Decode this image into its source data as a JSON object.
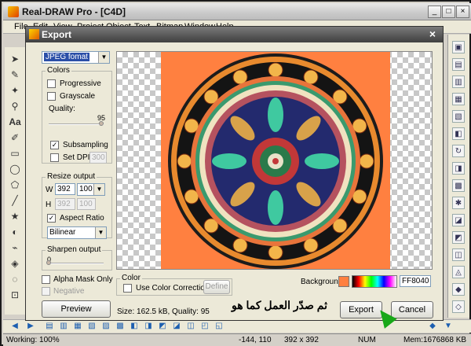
{
  "app": {
    "title": "Real-DRAW Pro - [C4D]",
    "window_buttons": [
      "_",
      "□",
      "×"
    ]
  },
  "menu": [
    "File",
    "Edit",
    "View",
    "Project",
    "Object",
    "Text",
    "Bitmap",
    "Window",
    "Help"
  ],
  "dialog": {
    "title": "Export",
    "close": "×",
    "format": "JPEG fomat",
    "colors": {
      "group_label": "Colors",
      "progressive": "Progressive",
      "grayscale": "Grayscale",
      "quality_label": "Quality:",
      "quality_value": "95",
      "quality_fraction": 0.95,
      "subsampling": "Subsampling",
      "set_dpi": "Set DPI",
      "dpi_value": "300"
    },
    "resize": {
      "group_label": "Resize output",
      "w_label": "W",
      "w_value": "392",
      "w_percent": "100",
      "h_label": "H",
      "h_value": "392",
      "h_percent": "100",
      "aspect_ratio": "Aspect Ratio",
      "method": "Bilinear"
    },
    "sharpen": {
      "group_label": "Sharpen output",
      "value": "0",
      "fraction": 0.0
    },
    "alpha_mask": "Alpha Mask Only",
    "negative": "Negative",
    "preview_button": "Preview",
    "color_group": {
      "label": "Color",
      "use_correction": "Use Color Correction",
      "define": "Define"
    },
    "background_label": "Background",
    "background_value": "FF8040",
    "background_color": "#ff8040",
    "size_info": "Size: 162.5 kB,  Quality: 95",
    "export_button": "Export",
    "cancel_button": "Cancel",
    "annotation": "ثم صدّر العمل كما هو"
  },
  "status": {
    "working": "Working: 100%",
    "coords": "-144, 110",
    "dims": "392 x 392",
    "num": "NUM",
    "mem": "Mem:1676868 KB"
  }
}
